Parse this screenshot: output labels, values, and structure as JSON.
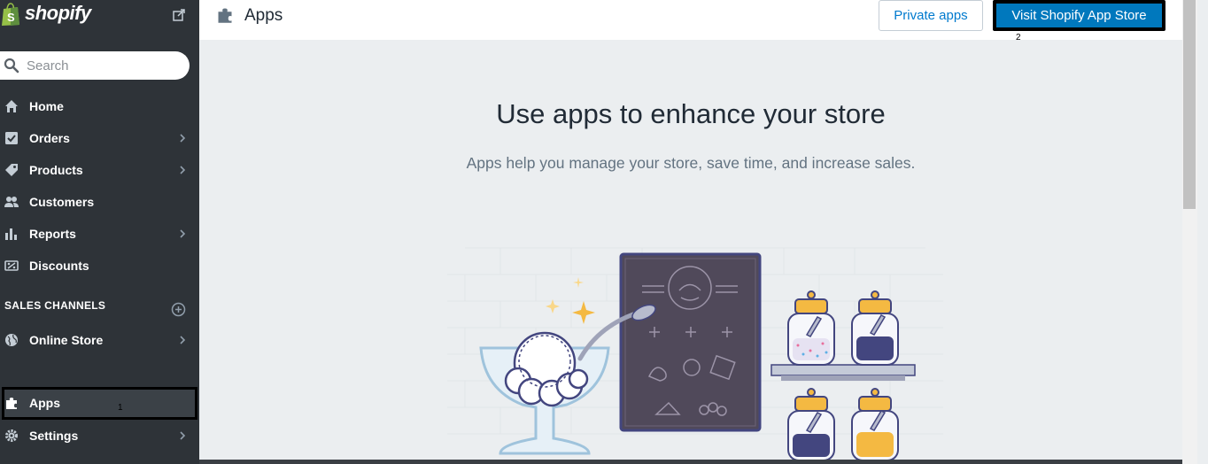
{
  "brand": {
    "name": "shopify"
  },
  "search": {
    "placeholder": "Search"
  },
  "sidebar": {
    "items": [
      {
        "label": "Home"
      },
      {
        "label": "Orders"
      },
      {
        "label": "Products"
      },
      {
        "label": "Customers"
      },
      {
        "label": "Reports"
      },
      {
        "label": "Discounts"
      }
    ],
    "section_heading": "SALES CHANNELS",
    "channels": [
      {
        "label": "Online Store"
      }
    ],
    "bottom": [
      {
        "label": "Apps"
      },
      {
        "label": "Settings"
      }
    ]
  },
  "topbar": {
    "title": "Apps",
    "private_apps_label": "Private apps",
    "visit_store_label": "Visit Shopify App Store"
  },
  "main": {
    "heading": "Use apps to enhance your store",
    "subheading": "Apps help you manage your store, save time, and increase sales."
  },
  "annotations": {
    "apps_marker": "1",
    "store_marker": "2"
  },
  "colors": {
    "sidebar_bg": "#2e3338",
    "primary_button": "#0078bd",
    "link_blue": "#007ace",
    "content_bg": "#ebeef0"
  }
}
